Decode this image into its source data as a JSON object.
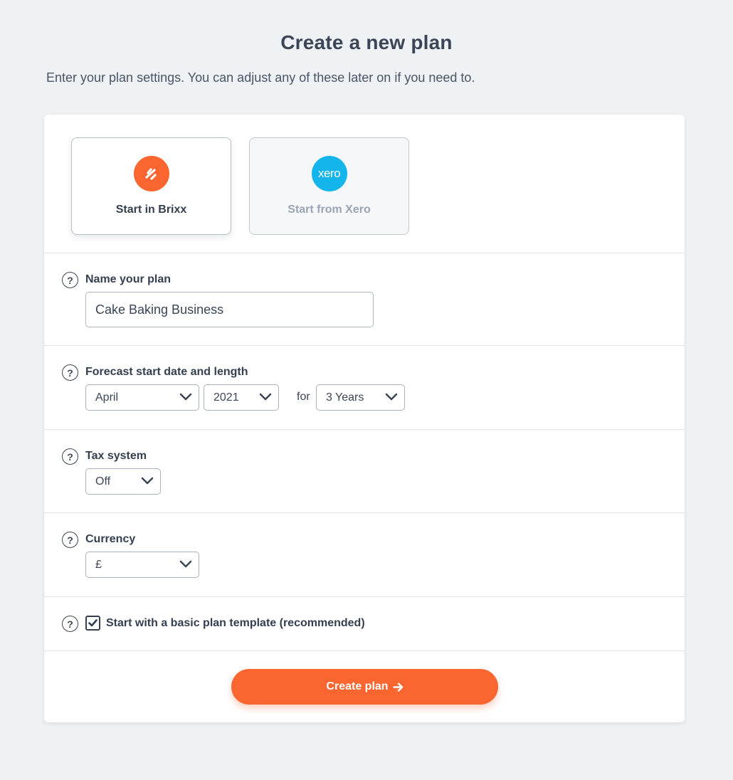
{
  "header": {
    "title": "Create a new plan",
    "subtitle": "Enter your plan settings. You can adjust any of these later on if you need to."
  },
  "sources": {
    "brixx": {
      "label": "Start in Brixx",
      "selected": true,
      "color": "#fb6530"
    },
    "xero": {
      "label": "Start from Xero",
      "logo_text": "xero",
      "disabled": true,
      "color": "#13b5ea"
    }
  },
  "plan_name": {
    "label": "Name your plan",
    "value": "Cake Baking Business",
    "help": "?"
  },
  "forecast": {
    "label": "Forecast start date and length",
    "month": "April",
    "year": "2021",
    "for_label": "for",
    "length": "3 Years",
    "help": "?"
  },
  "tax": {
    "label": "Tax system",
    "value": "Off",
    "help": "?"
  },
  "currency": {
    "label": "Currency",
    "value": "£",
    "help": "?"
  },
  "template": {
    "label": "Start with a basic plan template (recommended)",
    "checked": true,
    "help": "?"
  },
  "actions": {
    "create_label": "Create plan",
    "accent": "#fb6530"
  }
}
